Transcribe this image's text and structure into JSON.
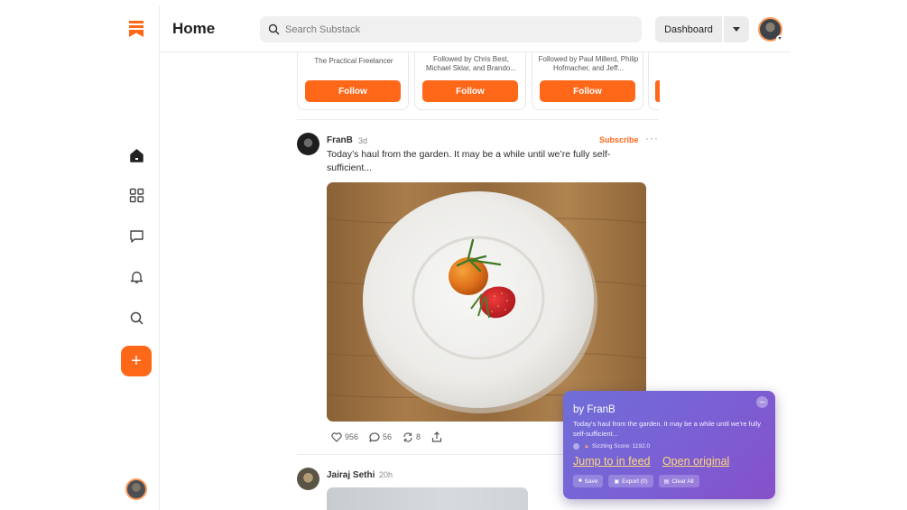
{
  "header": {
    "title": "Home",
    "search_placeholder": "Search Substack",
    "dashboard_label": "Dashboard"
  },
  "sidebar": {
    "items": [
      {
        "icon": "home-icon"
      },
      {
        "icon": "grid-icon"
      },
      {
        "icon": "chat-icon"
      },
      {
        "icon": "bell-icon"
      },
      {
        "icon": "search-icon"
      }
    ],
    "new_button": "+"
  },
  "recommendations": [
    {
      "subtitle": "The Practical Freelancer",
      "button": "Follow"
    },
    {
      "subtitle": "Followed by Chris Best, Michael Sklar, and Brando...",
      "button": "Follow"
    },
    {
      "subtitle": "Followed by Paul Millerd, Philip Hofmacher, and Jeff...",
      "button": "Follow"
    }
  ],
  "post": {
    "author": "FranB",
    "time": "3d",
    "subscribe_label": "Subscribe",
    "more_label": "···",
    "text": "Today’s haul from the garden. It may be a while until we’re fully self-sufficient...",
    "likes": "956",
    "comments": "56",
    "restacks": "8"
  },
  "post2": {
    "author": "Jairaj Sethi",
    "time": "20h"
  },
  "panel": {
    "title": "by FranB",
    "text": "Today's haul from the garden. It may be a while until we're fully self-sufficient...",
    "score": "Sizzling Score: 1192.0",
    "link_jump": "Jump to in feed",
    "link_open": "Open original",
    "btn_save": "Save",
    "btn_export": "Export (0)",
    "btn_clear": "Clear All",
    "close_label": "–"
  },
  "colors": {
    "brand": "#ff6719",
    "panel_gradient_start": "#6f6ed8",
    "panel_gradient_end": "#8650c9",
    "link_yellow": "#ffd97a"
  }
}
